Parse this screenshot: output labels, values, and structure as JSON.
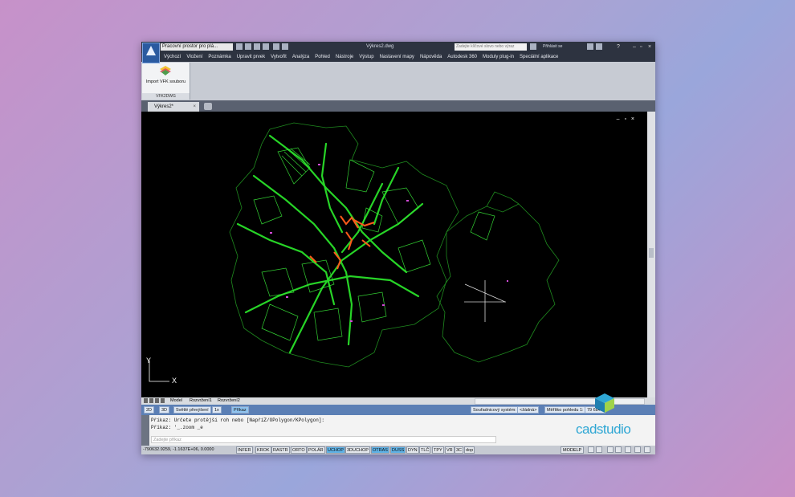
{
  "titlebar": {
    "workspace": "Pracovní prostor pro plá...",
    "document_title": "Výkres2.dwg",
    "search_placeholder": "Zadejte klíčové slovo nebo výraz",
    "signin": "Přihlásit se",
    "help": "?"
  },
  "menu": [
    "Výchozí",
    "Vložení",
    "Poznámka",
    "Upravit prvek",
    "Vytvořit",
    "Analýza",
    "Pohled",
    "Nástroje",
    "Výstup",
    "Nastavení mapy",
    "Nápověda",
    "Autodesk 360",
    "Moduly plug-in",
    "Speciální aplikace"
  ],
  "ribbon": {
    "button_label": "Import VFK souboru",
    "panel_name": "VFK2DWG",
    "icon": "layers-icon"
  },
  "doc_tab": {
    "label": "Výkres2*",
    "close": "×"
  },
  "viewport": {
    "controls": "– ▫ ×",
    "ucs_y": "Y",
    "ucs_x": "X"
  },
  "layout_tabs": [
    "Model",
    "Rozvržení1",
    "Rozvržení2"
  ],
  "status_mid": {
    "mode_2d": "2D",
    "mode_3d": "3D",
    "visual_style": "Světlé převýšení",
    "scale": "1x",
    "command_label": "Příkaz",
    "coord_system": "Souřadnicový systém:",
    "coord_value": "<žádná>",
    "view_scale": "Měřítko pohledu 1:",
    "view_scale_value": "79 6845"
  },
  "command": {
    "line1": "Příkaz: Určete protější roh nebo [NapříZ/OPolygon/KPolygon]:",
    "line2": "Příkaz: '_.zoom _e",
    "input_placeholder": "Zadejte příkaz",
    "prompt_icon": "command-prompt-icon"
  },
  "status_bottom": {
    "coords": "-790632.9259, -1.1637E+06, 0.0000",
    "toggles": [
      {
        "label": "INFER",
        "on": false
      },
      {
        "label": "KROK",
        "on": false
      },
      {
        "label": "RASTR",
        "on": false
      },
      {
        "label": "ORTO",
        "on": false
      },
      {
        "label": "POLÁR",
        "on": false
      },
      {
        "label": "UCHOP",
        "on": true
      },
      {
        "label": "3DUCHOP",
        "on": false
      },
      {
        "label": "OTRAS",
        "on": true
      },
      {
        "label": "DUSS",
        "on": true
      },
      {
        "label": "DYN",
        "on": false
      },
      {
        "label": "TLČ",
        "on": false
      },
      {
        "label": "TPY",
        "on": false
      },
      {
        "label": "VR",
        "on": false
      },
      {
        "label": "3C",
        "on": false
      },
      {
        "label": "dop",
        "on": false
      }
    ],
    "model_label": "MODELP"
  },
  "brand": "cadstudio",
  "colors": {
    "map_green": "#2bdc2b",
    "map_orange": "#ff5a1a",
    "canvas": "#000000",
    "accent": "#5fb2e6",
    "brand": "#2fa7d4"
  }
}
